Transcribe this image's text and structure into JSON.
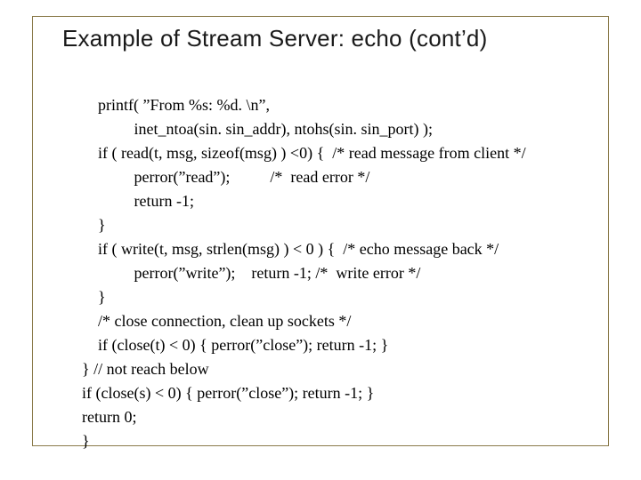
{
  "slide": {
    "title": "Example of Stream Server: echo (cont’d)",
    "code_lines": [
      "    printf( ”From %s: %d. \\n”,",
      "             inet_ntoa(sin. sin_addr), ntohs(sin. sin_port) );",
      "    if ( read(t, msg, sizeof(msg) ) <0) {  /* read message from client */",
      "             perror(”read”);          /*  read error */",
      "             return -1;",
      "    }",
      "    if ( write(t, msg, strlen(msg) ) < 0 ) {  /* echo message back */",
      "             perror(”write”);    return -1; /*  write error */",
      "    }",
      "    /* close connection, clean up sockets */",
      "    if (close(t) < 0) { perror(”close”); return -1; }",
      "} // not reach below",
      "if (close(s) < 0) { perror(”close”); return -1; }",
      "return 0;",
      "}"
    ]
  }
}
